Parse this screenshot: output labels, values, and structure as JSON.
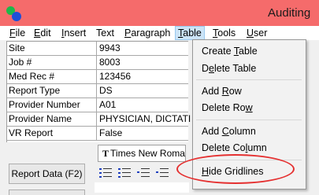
{
  "window": {
    "title": "Auditing"
  },
  "menubar": [
    {
      "label": "File",
      "ul": "F",
      "rest": "ile"
    },
    {
      "label": "Edit",
      "ul": "E",
      "rest": "dit"
    },
    {
      "label": "Insert",
      "ul": "I",
      "rest": "nsert"
    },
    {
      "label": "Text",
      "ul": "T",
      "rest": "ext",
      "ul_pos": "second"
    },
    {
      "label": "Paragraph",
      "ul": "P",
      "rest": "aragraph"
    },
    {
      "label": "Table",
      "ul": "T",
      "rest": "able",
      "active": true
    },
    {
      "label": "Tools",
      "ul": "T",
      "rest": "ools"
    },
    {
      "label": "User",
      "ul": "U",
      "rest": "ser"
    }
  ],
  "fields": [
    {
      "label": "Site",
      "value": "9943"
    },
    {
      "label": "Job #",
      "value": "8003"
    },
    {
      "label": "Med Rec #",
      "value": "123456"
    },
    {
      "label": "Report Type",
      "value": "DS"
    },
    {
      "label": "Provider Number",
      "value": "A01"
    },
    {
      "label": "Provider Name",
      "value": "PHYSICIAN, DICTATING"
    },
    {
      "label": "VR Report",
      "value": "False"
    }
  ],
  "toolbar": {
    "font_name": "Times New Roman",
    "report_button": "Report Data (F2)"
  },
  "table_menu": {
    "items": [
      {
        "pre": "Create ",
        "ul": "T",
        "post": "able"
      },
      {
        "pre": "D",
        "ul": "e",
        "post": "lete Table"
      },
      {
        "pre": "Add ",
        "ul": "R",
        "post": "ow"
      },
      {
        "pre": "Delete Ro",
        "ul": "w",
        "post": ""
      },
      {
        "pre": "Add ",
        "ul": "C",
        "post": "olumn"
      },
      {
        "pre": "Delete Co",
        "ul": "l",
        "post": "umn"
      },
      {
        "pre": "",
        "ul": "H",
        "post": "ide Gridlines"
      }
    ]
  },
  "colors": {
    "titlebar": "#f56b6b",
    "menu_active": "#cce4f7",
    "annotation": "#e53030"
  }
}
